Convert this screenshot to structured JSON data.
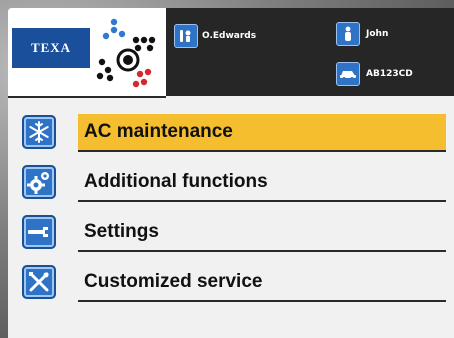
{
  "header": {
    "brand": "TEXA",
    "operator": "O.Edwards",
    "customer": "John",
    "plate": "AB123CD",
    "icons": [
      "mechanic-icon",
      "person-icon",
      "car-icon"
    ]
  },
  "menu": {
    "items": [
      {
        "label": "AC maintenance",
        "icon": "snowflake-icon",
        "selected": true
      },
      {
        "label": "Additional functions",
        "icon": "gears-icon",
        "selected": false
      },
      {
        "label": "Settings",
        "icon": "wrench-icon",
        "selected": false
      },
      {
        "label": "Customized service",
        "icon": "tools-icon",
        "selected": false
      }
    ]
  },
  "colors": {
    "selected_bg": "#f5be2f",
    "icon_blue": "#2e73c6",
    "header_dark": "#262626"
  }
}
